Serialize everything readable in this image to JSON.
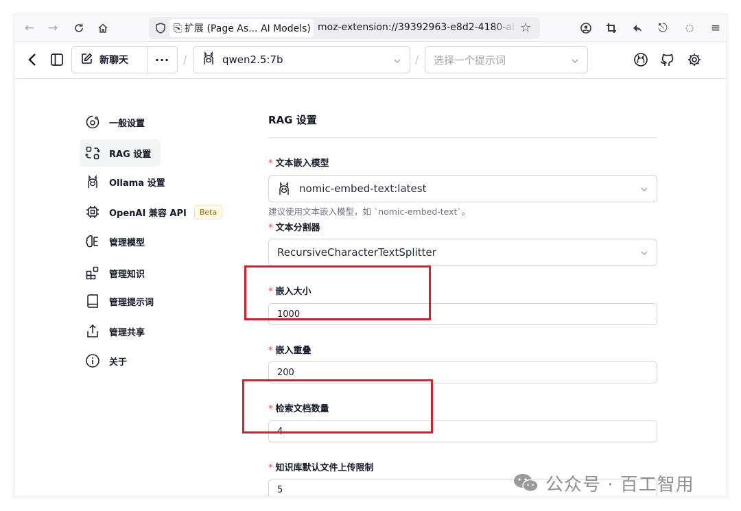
{
  "browser": {
    "extension_chip": "扩展 (Page As... AI Models)",
    "url": "moz-extension://39392963-e8d2-4180-ab79-",
    "icons": [
      "back-icon",
      "forward-icon",
      "reload-icon",
      "home-icon",
      "shield-icon",
      "bookmark-star-icon",
      "account-icon",
      "screenshot-crop-icon",
      "reply-icon",
      "share-icon",
      "chat-icon",
      "menu-icon"
    ]
  },
  "header": {
    "new_chat_label": "新聊天",
    "more_label": "···",
    "separator": "/",
    "model_selected": "qwen2.5:7b",
    "prompt_placeholder": "选择一个提示词",
    "icons": [
      "back-chevron-icon",
      "sidebar-toggle-icon",
      "edit-icon",
      "llama-icon",
      "chevron-down-icon",
      "ollama-circle-icon",
      "github-icon",
      "settings-gear-icon"
    ]
  },
  "nav": {
    "items": [
      {
        "label": "一般设置",
        "icon": "general-settings-icon"
      },
      {
        "label": "RAG 设置",
        "icon": "rag-icon",
        "active": true
      },
      {
        "label": "Ollama 设置",
        "icon": "llama-icon"
      },
      {
        "label": "OpenAI 兼容 API",
        "icon": "cpu-chip-icon",
        "badge": "Beta"
      },
      {
        "label": "管理模型",
        "icon": "brain-icon"
      },
      {
        "label": "管理知识",
        "icon": "blocks-icon"
      },
      {
        "label": "管理提示词",
        "icon": "book-icon"
      },
      {
        "label": "管理共享",
        "icon": "share-upload-icon"
      },
      {
        "label": "关于",
        "icon": "info-icon"
      }
    ]
  },
  "rag": {
    "title": "RAG 设置",
    "required_mark": "*",
    "embedding_model": {
      "label": "文本嵌入模型",
      "value": "nomic-embed-text:latest",
      "hint": "建议使用文本嵌入模型，如 `nomic-embed-text`。"
    },
    "splitter": {
      "label": "文本分割器",
      "value": "RecursiveCharacterTextSplitter"
    },
    "chunk_size": {
      "label": "嵌入大小",
      "value": "1000"
    },
    "chunk_overlap": {
      "label": "嵌入重叠",
      "value": "200"
    },
    "retrieved_docs": {
      "label": "检索文档数量",
      "value": "4"
    },
    "upload_limit": {
      "label": "知识库默认文件上传限制",
      "value": "5"
    }
  },
  "watermark": {
    "text": "公众号 · 百工智用"
  },
  "colors": {
    "highlight_box": "#d61f2a",
    "required": "#ef4444",
    "beta_badge_bg": "#fefce8",
    "active_nav_bg": "#f3f4f6"
  }
}
